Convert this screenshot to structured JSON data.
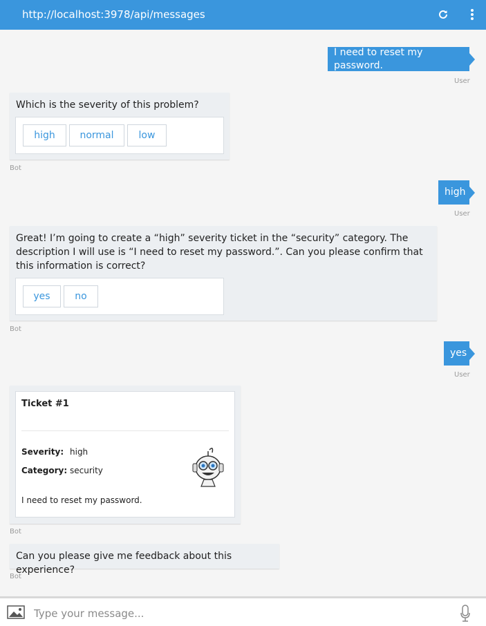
{
  "header": {
    "url": "http://localhost:3978/api/messages",
    "refresh_icon": "refresh-icon",
    "menu_icon": "more-vertical-icon"
  },
  "colors": {
    "accent": "#3a96dd",
    "bot_bubble": "#eceff2",
    "background": "#f5f5f5"
  },
  "messages": {
    "user1": {
      "text": "I need to reset my password.",
      "sender": "User"
    },
    "bot1": {
      "text": "Which is the severity of this problem?",
      "buttons": [
        "high",
        "normal",
        "low"
      ],
      "sender": "Bot"
    },
    "user2": {
      "text": "high",
      "sender": "User"
    },
    "bot2": {
      "text": "Great! I’m going to create a “high” severity ticket in the “security” category. The description I will use is “I need to reset my password.”. Can you please confirm that this information is correct?",
      "buttons": [
        "yes",
        "no"
      ],
      "sender": "Bot"
    },
    "user3": {
      "text": "yes",
      "sender": "User"
    },
    "bot3": {
      "ticket": {
        "title": "Ticket #1",
        "facts": [
          {
            "label": "Severity:",
            "value": "high"
          },
          {
            "label": "Category:",
            "value": "security"
          }
        ],
        "description": "I need to reset my password.",
        "image_icon": "robot-mascot-icon"
      },
      "sender": "Bot"
    },
    "bot4": {
      "text": "Can you please give me feedback about this experience?",
      "sender": "Bot"
    }
  },
  "composer": {
    "placeholder": "Type your message...",
    "value": "",
    "upload_icon": "image-upload-icon",
    "mic_icon": "microphone-icon"
  }
}
